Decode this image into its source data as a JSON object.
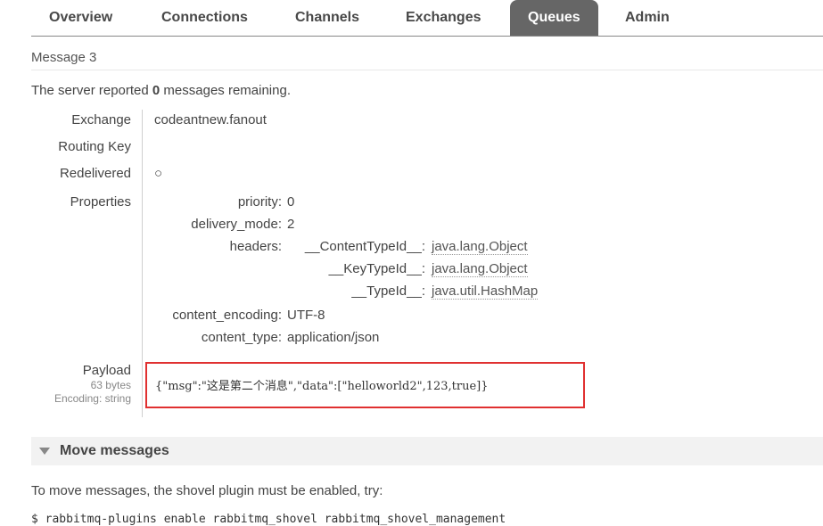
{
  "tabs": [
    {
      "label": "Overview"
    },
    {
      "label": "Connections"
    },
    {
      "label": "Channels"
    },
    {
      "label": "Exchanges"
    },
    {
      "label": "Queues"
    },
    {
      "label": "Admin"
    }
  ],
  "active_tab": "Queues",
  "section": {
    "title": "Message 3",
    "summary_prefix": "The server reported",
    "summary_count": "0",
    "summary_suffix": "messages remaining."
  },
  "message": {
    "exchange_label": "Exchange",
    "exchange_value": "codeantnew.fanout",
    "routing_key_label": "Routing Key",
    "routing_key_value": "",
    "redelivered_label": "Redelivered",
    "redelivered_value": "○",
    "properties_label": "Properties",
    "properties": {
      "priority_key": "priority:",
      "priority_value": "0",
      "delivery_mode_key": "delivery_mode:",
      "delivery_mode_value": "2",
      "headers_key": "headers:",
      "headers": [
        {
          "key": "__ContentTypeId__:",
          "value": "java.lang.Object"
        },
        {
          "key": "__KeyTypeId__:",
          "value": "java.lang.Object"
        },
        {
          "key": "__TypeId__:",
          "value": "java.util.HashMap"
        }
      ],
      "content_encoding_key": "content_encoding:",
      "content_encoding_value": "UTF-8",
      "content_type_key": "content_type:",
      "content_type_value": "application/json"
    },
    "payload_label": "Payload",
    "payload_size": "63 bytes",
    "payload_encoding": "Encoding: string",
    "payload_value": "{\"msg\":\"这是第二个消息\",\"data\":[\"helloworld2\",123,true]}"
  },
  "move": {
    "title": "Move messages",
    "note": "To move messages, the shovel plugin must be enabled, try:",
    "command": "$ rabbitmq-plugins enable rabbitmq_shovel rabbitmq_shovel_management"
  },
  "colors": {
    "active_tab_bg": "#666666",
    "highlight_border": "#e03030"
  }
}
